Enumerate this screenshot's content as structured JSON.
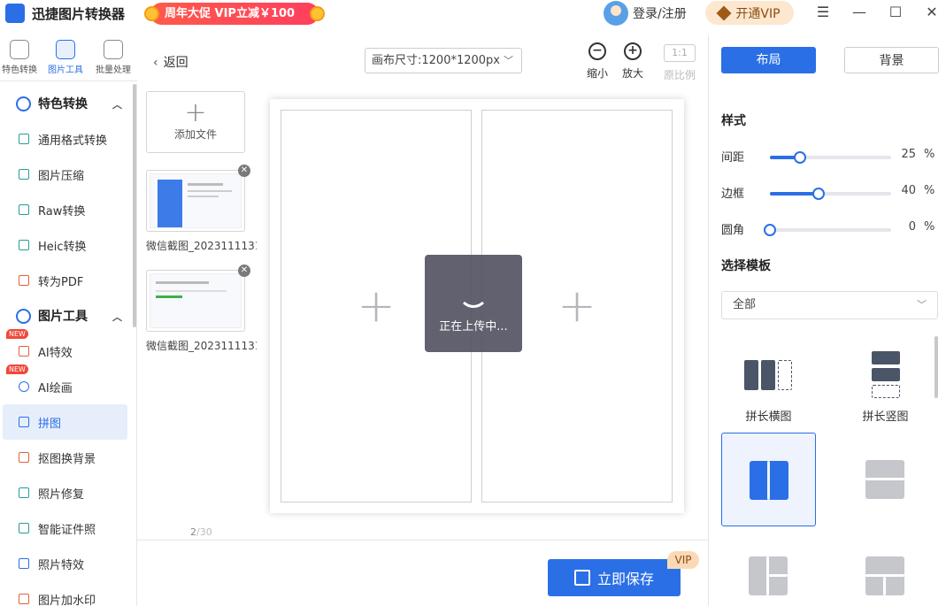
{
  "app": {
    "title": "迅捷图片转换器",
    "promo": "周年大促 VIP立减￥100"
  },
  "header": {
    "login": "登录/注册",
    "vip": "开通VIP"
  },
  "modes": [
    {
      "label": "特色转换"
    },
    {
      "label": "图片工具"
    },
    {
      "label": "批量处理"
    }
  ],
  "sidebar": {
    "group1": "特色转换",
    "items1": [
      "通用格式转换",
      "图片压缩",
      "Raw转换",
      "Heic转换",
      "转为PDF"
    ],
    "group2": "图片工具",
    "items2": [
      "AI特效",
      "AI绘画",
      "拼图",
      "抠图换背景",
      "照片修复",
      "智能证件照",
      "照片特效",
      "图片加水印"
    ],
    "new_badge": "NEW",
    "active": "拼图"
  },
  "toolbar": {
    "back": "返回",
    "canvas_size": "画布尺寸:1200*1200px",
    "zoom_out": "缩小",
    "zoom_in": "放大",
    "ratio_icon": "1:1",
    "ratio": "原比例"
  },
  "files": {
    "add": "添加文件",
    "items": [
      {
        "name": "微信截图_2023111131..."
      },
      {
        "name": "微信截图_2023111131..."
      }
    ],
    "count": "2",
    "total": "30"
  },
  "canvas": {
    "loading": "正在上传中..."
  },
  "footer": {
    "save": "立即保存",
    "vip_tag": "VIP"
  },
  "panel": {
    "tabs": [
      "布局",
      "背景"
    ],
    "style_title": "样式",
    "sliders": [
      {
        "label": "间距",
        "value": "25",
        "unit": "%",
        "fraction": 0.25
      },
      {
        "label": "边框",
        "value": "40",
        "unit": "%",
        "fraction": 0.4
      },
      {
        "label": "圆角",
        "value": "0",
        "unit": "%",
        "fraction": 0.0
      }
    ],
    "template_title": "选择模板",
    "template_filter": "全部",
    "templates": [
      "拼长横图",
      "拼长竖图"
    ]
  },
  "colors": {
    "accent": "#2b6fe6",
    "promo": "#ff4a52",
    "vip": "#fde7cf"
  }
}
